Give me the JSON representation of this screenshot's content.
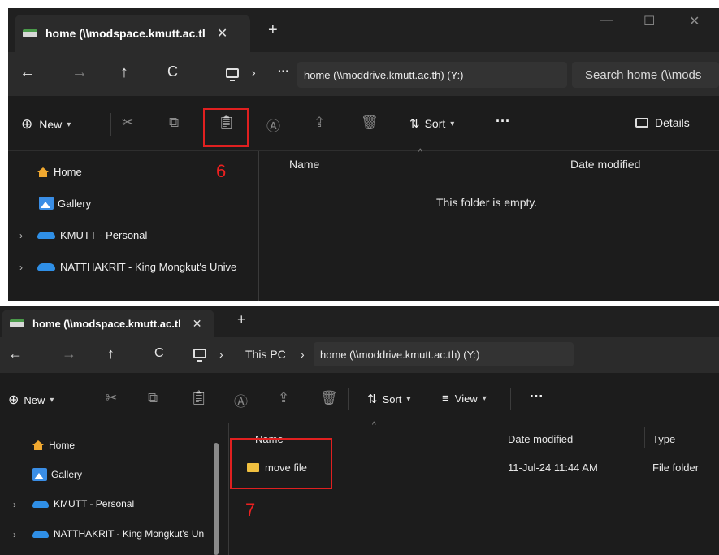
{
  "shot1": {
    "tab": {
      "title": "home (\\\\modspace.kmutt.ac.tl",
      "close": "✕"
    },
    "new_tab": "+",
    "window_controls": {
      "minimize": "—",
      "maximize": "☐",
      "close": "✕"
    },
    "nav": {
      "back": "←",
      "forward": "→",
      "up": "↑",
      "refresh": "C",
      "chevron": "›",
      "more": "···"
    },
    "address": "home (\\\\moddrive.kmutt.ac.th) (Y:)",
    "search_placeholder": "Search home (\\\\mods",
    "toolbar": {
      "new_label": "New",
      "sort_label": "Sort",
      "more": "···",
      "details_label": "Details"
    },
    "sidebar": {
      "items": [
        {
          "label": "Home"
        },
        {
          "label": "Gallery"
        },
        {
          "label": "KMUTT - Personal"
        },
        {
          "label": "NATTHAKRIT - King Mongkut's Unive"
        }
      ]
    },
    "columns": {
      "name": "Name",
      "date": "Date modified"
    },
    "empty_message": "This folder is empty.",
    "annotation": "6"
  },
  "shot2": {
    "tab": {
      "title": "home (\\\\modspace.kmutt.ac.tl",
      "close": "✕"
    },
    "new_tab": "+",
    "nav": {
      "back": "←",
      "forward": "→",
      "up": "↑",
      "refresh": "C",
      "chevron": "›"
    },
    "breadcrumb": {
      "this_pc": "This PC",
      "current": "home (\\\\moddrive.kmutt.ac.th) (Y:)"
    },
    "toolbar": {
      "new_label": "New",
      "sort_label": "Sort",
      "view_label": "View",
      "more": "···"
    },
    "sidebar": {
      "items": [
        {
          "label": "Home"
        },
        {
          "label": "Gallery"
        },
        {
          "label": "KMUTT - Personal"
        },
        {
          "label": "NATTHAKRIT - King Mongkut's Un"
        }
      ]
    },
    "columns": {
      "name": "Name",
      "date": "Date modified",
      "type": "Type"
    },
    "files": [
      {
        "name": "move file",
        "date": "11-Jul-24 11:44 AM",
        "type": "File folder"
      }
    ],
    "annotation": "7"
  },
  "colors": {
    "annotation_red": "#e02020",
    "folder": "#f0c040",
    "onedrive": "#2f8fe6"
  }
}
